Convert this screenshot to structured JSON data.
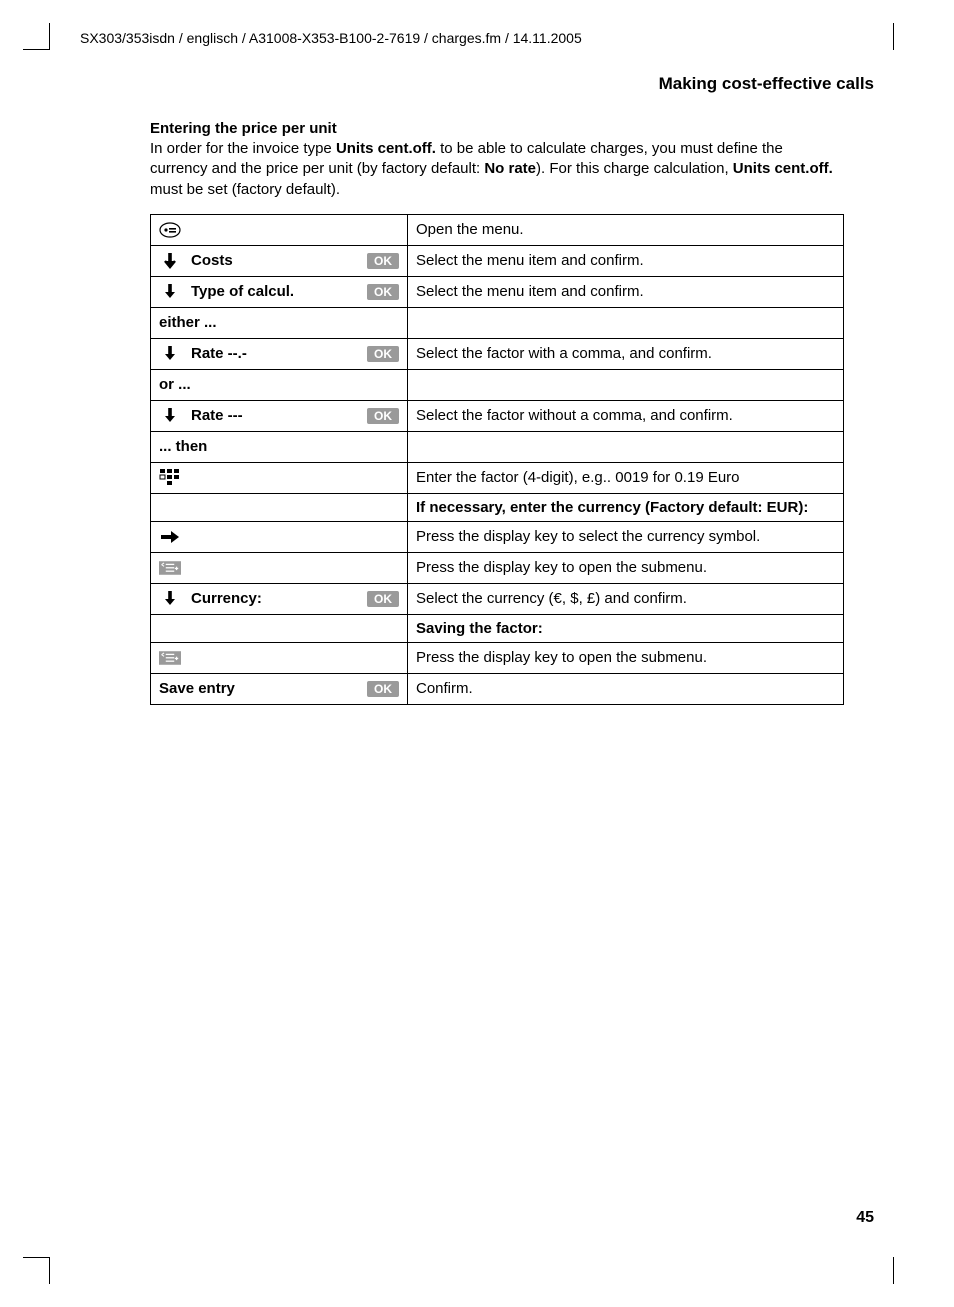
{
  "doc_path": "SX303/353isdn / englisch / A31008-X353-B100-2-7619 / charges.fm / 14.11.2005",
  "section_title": "Making cost-effective calls",
  "subhead": "Entering the price per unit",
  "intro_parts": {
    "p1": "In order for the invoice type ",
    "b1": "Units cent.off.",
    "p2": " to be able to calculate charges, you must define the currency and the price per unit (by factory default: ",
    "b2": "No rate",
    "p3": "). For this charge calculation, ",
    "b3": "Units cent.off.",
    "p4": " must be set (factory default)."
  },
  "ok_label": "OK",
  "rows": {
    "r1_label": "",
    "r1_desc": "Open the menu.",
    "r2_label": "Costs",
    "r2_desc": "Select the menu item and confirm.",
    "r3_label": "Type of calcul.",
    "r3_desc": "Select the menu item and confirm.",
    "r4_label": "either ...",
    "r5_label": "Rate --.-",
    "r5_desc": "Select the factor with a comma, and confirm.",
    "r6_label": "or ...",
    "r7_label": "Rate ---",
    "r7_desc": "Select the factor without a comma, and confirm.",
    "r8_label": "... then",
    "r9_desc": "Enter the factor (4-digit), e.g.. 0019 for 0.19 Euro",
    "r10_desc": "If necessary, enter the currency (Factory default: EUR):",
    "r11_desc": "Press the display key to select the currency symbol.",
    "r12_desc": "Press the display key to open the submenu.",
    "r13_label": "Currency:",
    "r13_desc": "Select the currency (€, $, £) and confirm.",
    "r14_desc": "Saving the factor:",
    "r15_desc": "Press the display key to open the submenu.",
    "r16_label": "Save entry",
    "r16_desc": "Confirm."
  },
  "page_number": "45"
}
